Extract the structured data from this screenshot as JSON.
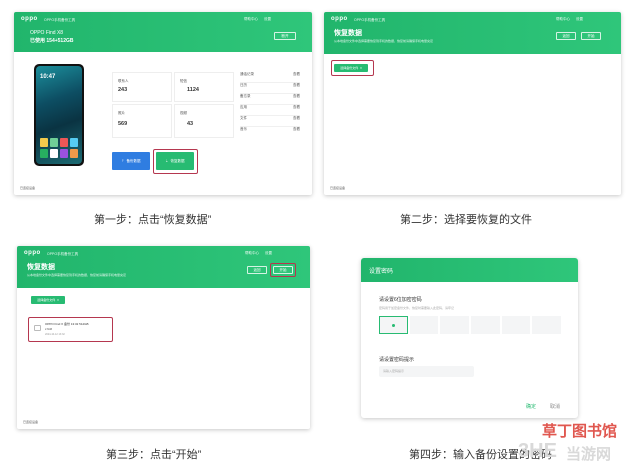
{
  "panels": {
    "p1": {
      "brand": "oppo",
      "app_name": "OPPO手机备份工具",
      "menu": [
        "帮助中心",
        "设置"
      ],
      "device_name": "OPPO Find X8",
      "storage": "已使用 154+512GB",
      "header_btn": "断开",
      "phone_time": "10:47",
      "stats": [
        {
          "label": "联系人",
          "value": "243"
        },
        {
          "label": "短信",
          "value": "1124"
        },
        {
          "label": "照片",
          "value": "569"
        },
        {
          "label": "视频",
          "value": "43"
        }
      ],
      "list": [
        {
          "label": "通话记录",
          "value": "查看"
        },
        {
          "label": "日历",
          "value": "查看"
        },
        {
          "label": "备忘录",
          "value": "查看"
        },
        {
          "label": "应用",
          "value": "查看"
        },
        {
          "label": "文件",
          "value": "查看"
        },
        {
          "label": "音乐",
          "value": "查看"
        }
      ],
      "backup_btn": "备份数据",
      "restore_btn": "恢复数据",
      "footer": "已连接设备"
    },
    "p2": {
      "brand": "oppo",
      "app_name": "OPPO手机备份工具",
      "menu": [
        "帮助中心",
        "设置"
      ],
      "title": "恢复数据",
      "subtitle": "从本地备份文件中选择需要恢复到手机的数据，恢复前请确保手机电量充足",
      "btn_back": "返回",
      "btn_start": "开始",
      "select_btn": "选择备份文件",
      "footer": "已连接设备"
    },
    "p3": {
      "brand": "oppo",
      "app_name": "OPPO手机备份工具",
      "menu": [
        "帮助中心",
        "设置"
      ],
      "title": "恢复数据",
      "subtitle": "从本地备份文件中选择需要恢复到手机的数据，恢复前请确保手机电量充足",
      "btn_back": "返回",
      "btn_start": "开始",
      "select_btn": "选择备份文件",
      "file_name": "OPPO Find X 备份 13:32 512GB",
      "file_meta": "2.6GB",
      "file_date": "2024-10-12 13:32",
      "footer": "已连接设备"
    },
    "p4": {
      "title": "设置密码",
      "pw_label": "请设置6位加密密码",
      "pw_hint": "密码用于加密备份文件，恢复时需要输入此密码，请牢记",
      "hint_label": "请设置密码提示",
      "hint_placeholder": "请输入密码提示",
      "ok": "确定",
      "cancel": "取消"
    }
  },
  "captions": {
    "step1": "第一步：点击“恢复数据”",
    "step2": "第二步：选择要恢复的文件",
    "step3": "第三步：点击“开始”",
    "step4": "第四步：输入备份设置的密码"
  },
  "watermark": {
    "line1": "草丁图书馆",
    "line2": "当游网",
    "logo": "3HE"
  },
  "colors": {
    "accent": "#27bb72",
    "highlight": "#b5374f",
    "blue": "#2f7de1"
  }
}
